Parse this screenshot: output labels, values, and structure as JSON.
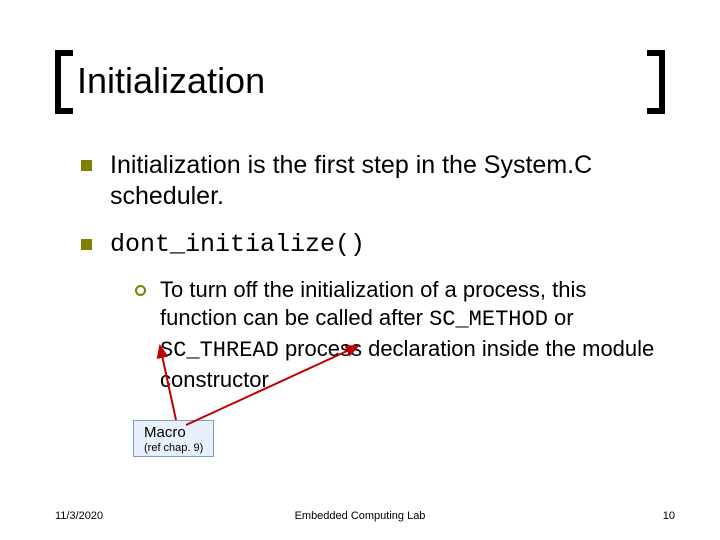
{
  "title": "Initialization",
  "bullets": [
    {
      "text": "Initialization is the first step in the System.C scheduler."
    },
    {
      "text_mono": "dont_initialize()"
    }
  ],
  "sub": {
    "line1": "To turn off the initialization of a process, this function can be called after",
    "code1": "SC_METHOD",
    "mid": " or ",
    "code2": "SC_THREAD",
    "tail": " process declaration inside the module constructor"
  },
  "macro": {
    "label": "Macro",
    "note": "(ref chap. 9)"
  },
  "footer": {
    "date": "11/3/2020",
    "center": "Embedded Computing Lab",
    "page": "10"
  }
}
